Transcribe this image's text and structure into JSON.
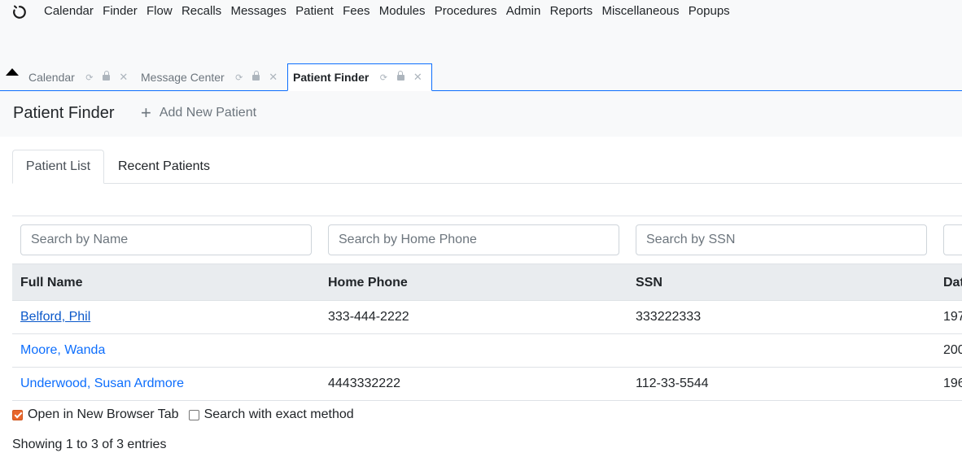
{
  "top_menu": {
    "logo_icon": "openemr-logo-icon",
    "items": [
      "Calendar",
      "Finder",
      "Flow",
      "Recalls",
      "Messages",
      "Patient",
      "Fees",
      "Modules",
      "Procedures",
      "Admin",
      "Reports",
      "Miscellaneous",
      "Popups"
    ]
  },
  "window_tabs": [
    {
      "label": "Calendar",
      "active": false
    },
    {
      "label": "Message Center",
      "active": false
    },
    {
      "label": "Patient Finder",
      "active": true
    }
  ],
  "page_header": {
    "title": "Patient Finder",
    "add_patient_label": "Add New Patient"
  },
  "nav_tabs": [
    "Patient List",
    "Recent Patients"
  ],
  "search": {
    "name_placeholder": "Search by Name",
    "phone_placeholder": "Search by Home Phone",
    "ssn_placeholder": "Search by SSN",
    "dob_placeholder": "S"
  },
  "table": {
    "headers": [
      "Full Name",
      "Home Phone",
      "SSN",
      "Dat"
    ],
    "rows": [
      {
        "name": "Belford, Phil",
        "phone": "333-444-2222",
        "ssn": "333222333",
        "dob": "197"
      },
      {
        "name": "Moore, Wanda",
        "phone": "",
        "ssn": "",
        "dob": "200"
      },
      {
        "name": "Underwood, Susan Ardmore",
        "phone": "4443332222",
        "ssn": "112-33-5544",
        "dob": "196"
      }
    ]
  },
  "options": {
    "open_new_tab_label": "Open in New Browser Tab",
    "open_new_tab_checked": true,
    "exact_search_label": "Search with exact method",
    "exact_search_checked": false
  },
  "info": "Showing 1 to 3 of 3 entries",
  "colors": {
    "accent": "#0d6efd",
    "checkbox_checked": "#e8662c"
  }
}
